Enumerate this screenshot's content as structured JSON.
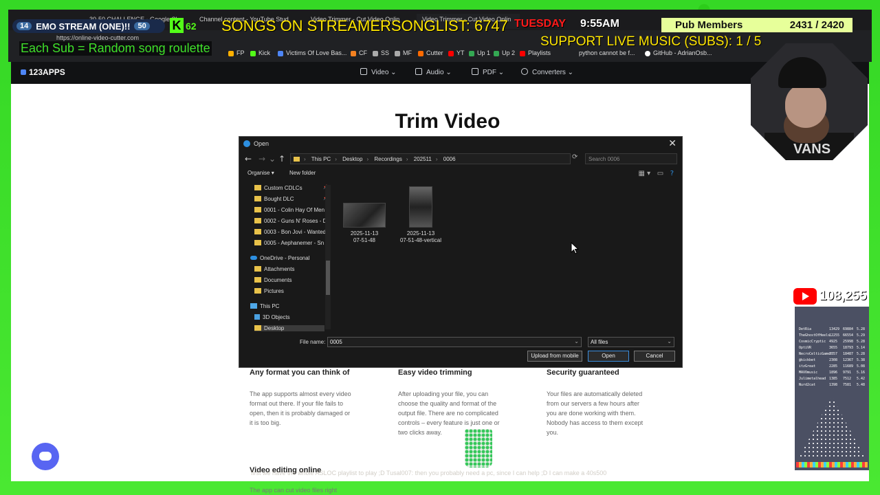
{
  "overlay": {
    "counter_left": "14",
    "counter_text": "EMO STREAM (ONE)!!",
    "counter_right": "50",
    "kick_count": "62",
    "songs_text": "SONGS ON STREAMERSONGLIST: 6747",
    "day": "TUESDAY",
    "time": "9:55AM",
    "pub_label": "Pub Members",
    "pub_count": "2431 / 2420",
    "support_text": "SUPPORT LIVE MUSIC (SUBS): 1 / 5",
    "roulette_text": "Each Sub = Random song roulette",
    "youtube_count": "108,255"
  },
  "browser": {
    "tabs": [
      "30-50 CHALLENGE - Google She",
      "Channel content - YouTube Stud",
      "Video Trimmer - Cut Video Onlin",
      "Video Trimmer - Cut Video Onlin"
    ],
    "url": "https://online-video-cutter.com",
    "bookmarks": [
      "FP",
      "Kick",
      "Victims Of Love Bas...",
      "CF",
      "SS",
      "MF",
      "Cutter",
      "YT",
      "Up 1",
      "Up 2",
      "Playlists",
      "python cannot be f...",
      "GitHub - AdrianOsb..."
    ]
  },
  "site": {
    "logo": "123APPS",
    "nav": [
      "Video",
      "Audio",
      "PDF",
      "Converters"
    ],
    "heading": "Trim Video",
    "features": [
      {
        "title": "Any format you can think of",
        "text": "The app supports almost every video format out there. If your file fails to open, then it is probably damaged or it is too big."
      },
      {
        "title": "Easy video trimming",
        "text": "After uploading your file, you can choose the quality and format of the output file. There are no complicated controls – every feature is just one or two clicks away."
      },
      {
        "title": "Security guaranteed",
        "text": "Your files are automatically deleted from our servers a few hours after you are done working with them. Nobody has access to them except you."
      }
    ],
    "sub_title": "Video editing online",
    "sub_text": "The app can cut video files right"
  },
  "dialog": {
    "title": "Open",
    "breadcrumb": [
      "This PC",
      "Desktop",
      "Recordings",
      "202511",
      "0006"
    ],
    "search_placeholder": "Search 0006",
    "organise": "Organise",
    "new_folder": "New folder",
    "tree": [
      {
        "label": "Custom CDLCs",
        "type": "folder",
        "pinned": true
      },
      {
        "label": "Bought DLC",
        "type": "folder",
        "pinned": true
      },
      {
        "label": "0001 - Colin Hay Of Men",
        "type": "folder"
      },
      {
        "label": "0002 - Guns N' Roses - D",
        "type": "folder"
      },
      {
        "label": "0003 - Bon Jovi - Wanted",
        "type": "folder"
      },
      {
        "label": "0005 - Aephanemer - Sn",
        "type": "folder"
      },
      {
        "label": "OneDrive - Personal",
        "type": "cloud"
      },
      {
        "label": "Attachments",
        "type": "folder"
      },
      {
        "label": "Documents",
        "type": "folder"
      },
      {
        "label": "Pictures",
        "type": "folder"
      },
      {
        "label": "This PC",
        "type": "pc"
      },
      {
        "label": "3D Objects",
        "type": "cube"
      },
      {
        "label": "Desktop",
        "type": "folder",
        "selected": true
      }
    ],
    "files": [
      {
        "line1": "2025-11-13",
        "line2": "07-51-48"
      },
      {
        "line1": "2025-11-13",
        "line2": "07-51-48-vertical"
      }
    ],
    "file_name_label": "File name:",
    "file_name_value": "0005",
    "file_type": "All files",
    "btn_upload": "Upload from mobile",
    "btn_open": "Open",
    "btn_cancel": "Cancel"
  },
  "leaderboard": [
    [
      "DetRia",
      "13429",
      "69884",
      "5.28"
    ],
    [
      "TheGhostOfHeels",
      "12255",
      "66554",
      "5.29"
    ],
    [
      "CosmicCryptic",
      "4925",
      "25998",
      "5.28"
    ],
    [
      "OptiVR",
      "3655",
      "18793",
      "5.14"
    ],
    [
      "NecroCelticGamer",
      "3357",
      "18487",
      "5.28"
    ],
    [
      "@kickbet",
      "2308",
      "12367",
      "5.38"
    ],
    [
      "itzGreat",
      "2285",
      "11689",
      "5.08"
    ],
    [
      "MAVOmusic",
      "1896",
      "9791",
      "5.16"
    ],
    [
      "Julimetalhead",
      "1385",
      "7512",
      "5.42"
    ],
    [
      "Nurd2cat",
      "1398",
      "7581",
      "5.48"
    ]
  ],
  "ticker_text": "first we have the whole ASLOC playlist to play ;D   Tusal007: then you probably need a pc, since I can help ;D I can make a 40s500"
}
